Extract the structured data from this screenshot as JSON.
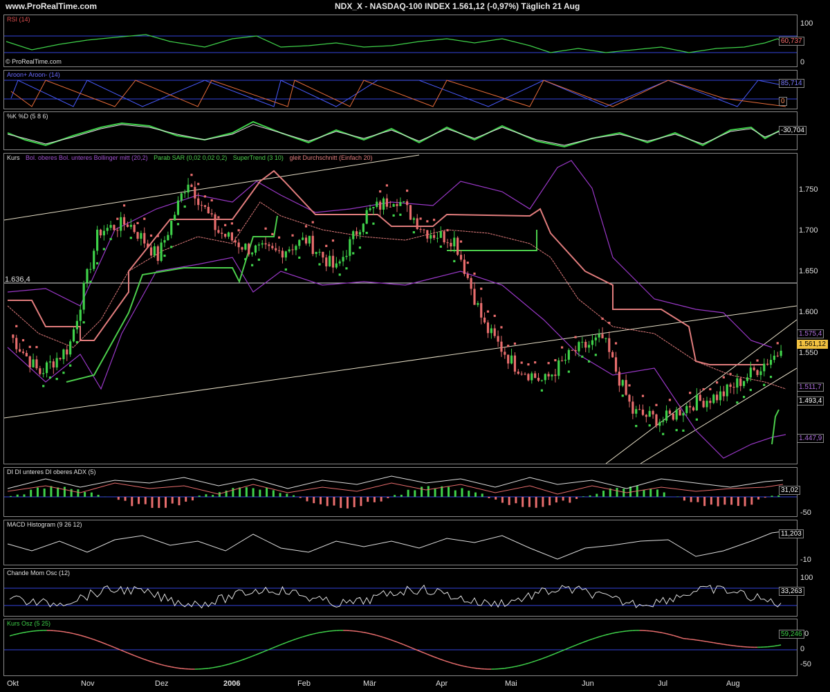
{
  "header": {
    "site": "www.ProRealTime.com",
    "title": "NDX_X - NASDAQ-100 INDEX    1.561,12 (-0,97%)    Täglich  21 Aug"
  },
  "copyright": "© ProRealTime.com",
  "colors": {
    "bull": "#3fd24a",
    "bear": "#e86d6d",
    "band": "#9a38c8",
    "sar": "#e27d7d",
    "supertrend_up": "#4ccf4c",
    "level": "#e0e0e0",
    "zone": "#3344dd"
  },
  "panes": {
    "rsi": {
      "label": "RSI (14)",
      "value": "60,737",
      "ticks": [
        "100",
        "0"
      ]
    },
    "aroon": {
      "label": "Aroon+ Aroon- (14)",
      "value1": "85,714",
      "value2": "0"
    },
    "stoch": {
      "label": "%K %D (5 8 6)",
      "value": "-30,704"
    },
    "price": {
      "legend": [
        {
          "text": "Kurs",
          "color": "#e0e0e0"
        },
        {
          "text": "Bol. oberes Bol. unteres Bollinger mitt (20,2)",
          "color": "#a050d0"
        },
        {
          "text": "Parab SAR (0,02 0,02 0,2)",
          "color": "#4ccf4c"
        },
        {
          "text": "SuperTrend (3 10)",
          "color": "#4ccf4c"
        },
        {
          "text": "gleit Durchschnitt (Einfach 20)",
          "color": "#e27d7d"
        }
      ],
      "level_label": "1.636,4",
      "yticks": [
        "1.750",
        "1.700",
        "1.650",
        "1.600",
        "1.550"
      ],
      "tags": {
        "last": "1.561,12",
        "bb_upper": "1.575,4",
        "ma": "1.511,7",
        "sar": "1.493,4",
        "bb_lower": "1.447,9"
      }
    },
    "adx": {
      "label": "DI DI unteres DI oberes ADX (5)",
      "value": "31,02",
      "tick": "-50"
    },
    "macd": {
      "label": "MACD Histogram (9 26 12)",
      "value": "11,203",
      "tick": "-10"
    },
    "cmo": {
      "label": "Chande Mom Osc (12)",
      "value": "33,263",
      "tick": "100"
    },
    "kosz": {
      "label": "Kurs Osz (5 25)",
      "value": "59,246",
      "ticks": [
        "50",
        "0",
        "-50"
      ]
    }
  },
  "xaxis": [
    "Okt",
    "Nov",
    "Dez",
    "2006",
    "Feb",
    "Mär",
    "Apr",
    "Mai",
    "Jun",
    "Jul",
    "Aug"
  ],
  "chart_data": {
    "type": "candlestick",
    "title": "NDX_X - NASDAQ-100 INDEX",
    "period": "Täglich",
    "x": [
      "Okt",
      "Nov",
      "Dez",
      "2006",
      "Feb",
      "Mär",
      "Apr",
      "Mai",
      "Jun",
      "Jul",
      "Aug"
    ],
    "ylim": [
      1430,
      1790
    ],
    "approx_close": [
      1580,
      1535,
      1565,
      1700,
      1710,
      1670,
      1760,
      1700,
      1680,
      1675,
      1690,
      1655,
      1720,
      1740,
      1700,
      1690,
      1590,
      1545,
      1525,
      1560,
      1575,
      1490,
      1480,
      1500,
      1510,
      1535,
      1561.12
    ],
    "last_close": 1561.12,
    "change": "-0,97%",
    "horizontal_level": 1636.4
  }
}
